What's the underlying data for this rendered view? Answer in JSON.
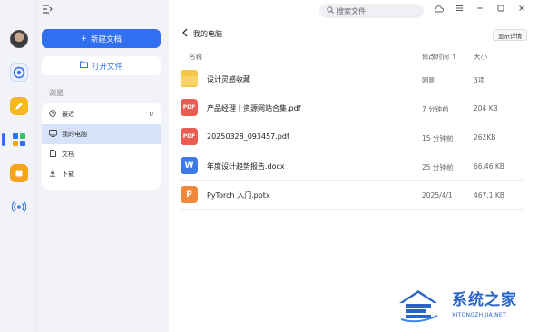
{
  "titlebar": {
    "search_placeholder": "搜索文件",
    "icons": [
      "menu-collapse-icon",
      "search-icon",
      "cloud-icon",
      "hamburger-icon",
      "minimize-icon",
      "maximize-icon",
      "close-icon"
    ]
  },
  "rail": {
    "apps": [
      {
        "name": "avatar"
      },
      {
        "name": "browser-app-icon",
        "color": "#3d6cf0"
      },
      {
        "name": "notes-app-icon",
        "color": "#f5b81f"
      },
      {
        "name": "files-app-icon",
        "color": "#2f6ff0"
      },
      {
        "name": "gallery-app-icon",
        "color": "#f6a419"
      },
      {
        "name": "share-app-icon",
        "color": "#3d7ae8"
      }
    ]
  },
  "nav": {
    "new_doc": "新建文档",
    "open_file": "打开文件",
    "section": "浏览",
    "items": [
      {
        "label": "最近",
        "count": "0"
      },
      {
        "label": "我的电脑",
        "count": ""
      },
      {
        "label": "文档",
        "count": ""
      },
      {
        "label": "下载",
        "count": ""
      }
    ],
    "active_index": 1
  },
  "main": {
    "breadcrumb": "我的电脑",
    "detail_button": "显示详情",
    "columns": {
      "name": "名称",
      "modified": "修改时间 ↑",
      "size": "大小"
    },
    "files": [
      {
        "icon": "folder",
        "icon_label": "",
        "name": "设计灵感收藏",
        "modified": "刚刚",
        "size": "3项"
      },
      {
        "icon": "pdf",
        "icon_label": "PDF",
        "name": "产品经理丨资源网站合集.pdf",
        "modified": "7 分钟前",
        "size": "204 KB"
      },
      {
        "icon": "pdf",
        "icon_label": "PDF",
        "name": "20250328_093457.pdf",
        "modified": "15 分钟前",
        "size": "262KB"
      },
      {
        "icon": "word",
        "icon_label": "W",
        "name": "年度设计趋势报告.docx",
        "modified": "25 分钟前",
        "size": "66.46 KB"
      },
      {
        "icon": "ppt",
        "icon_label": "P",
        "name": "PyTorch 入门.pptx",
        "modified": "2025/4/1",
        "size": "467.1 KB"
      }
    ]
  },
  "watermark": {
    "title": "系统之家",
    "url": "XITONGZHIJIA.NET"
  }
}
